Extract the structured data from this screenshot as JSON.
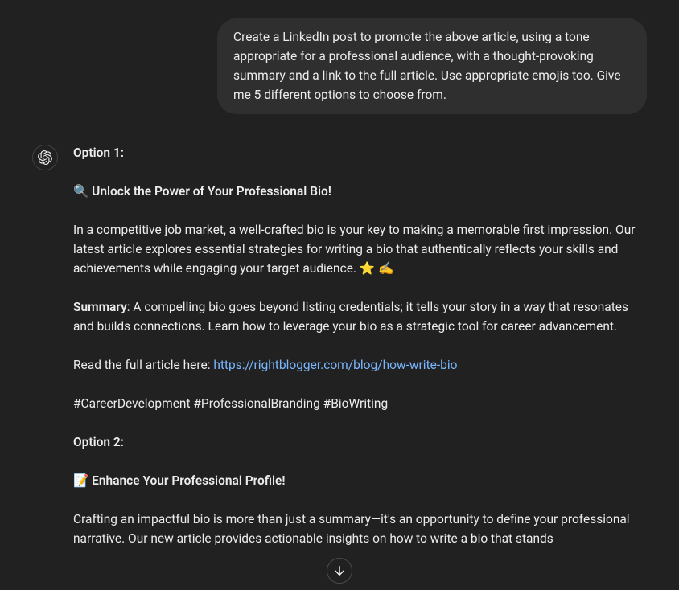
{
  "user_message": "Create a LinkedIn post to promote the above article, using a tone appropriate for a professional audience, with a thought-provoking summary and a link to the full article. Use appropriate emojis too. Give me 5 different options to choose from.",
  "assistant": {
    "option1": {
      "heading": "Option 1:",
      "title": "🔍 Unlock the Power of Your Professional Bio!",
      "body": "In a competitive job market, a well-crafted bio is your key to making a memorable first impression. Our latest article explores essential strategies for writing a bio that authentically reflects your skills and achievements while engaging your target audience. ⭐ ✍️",
      "summary_label": "Summary",
      "summary_text": ": A compelling bio goes beyond listing credentials; it tells your story in a way that resonates and builds connections. Learn how to leverage your bio as a strategic tool for career advancement.",
      "read_label": "Read the full article here: ",
      "link_url": "https://rightblogger.com/blog/how-write-bio",
      "hashtags": "#CareerDevelopment #ProfessionalBranding #BioWriting"
    },
    "option2": {
      "heading": "Option 2:",
      "title": "📝 Enhance Your Professional Profile!",
      "body": "Crafting an impactful bio is more than just a summary—it's an opportunity to define your professional narrative. Our new article provides actionable insights on how to write a bio that stands"
    }
  }
}
